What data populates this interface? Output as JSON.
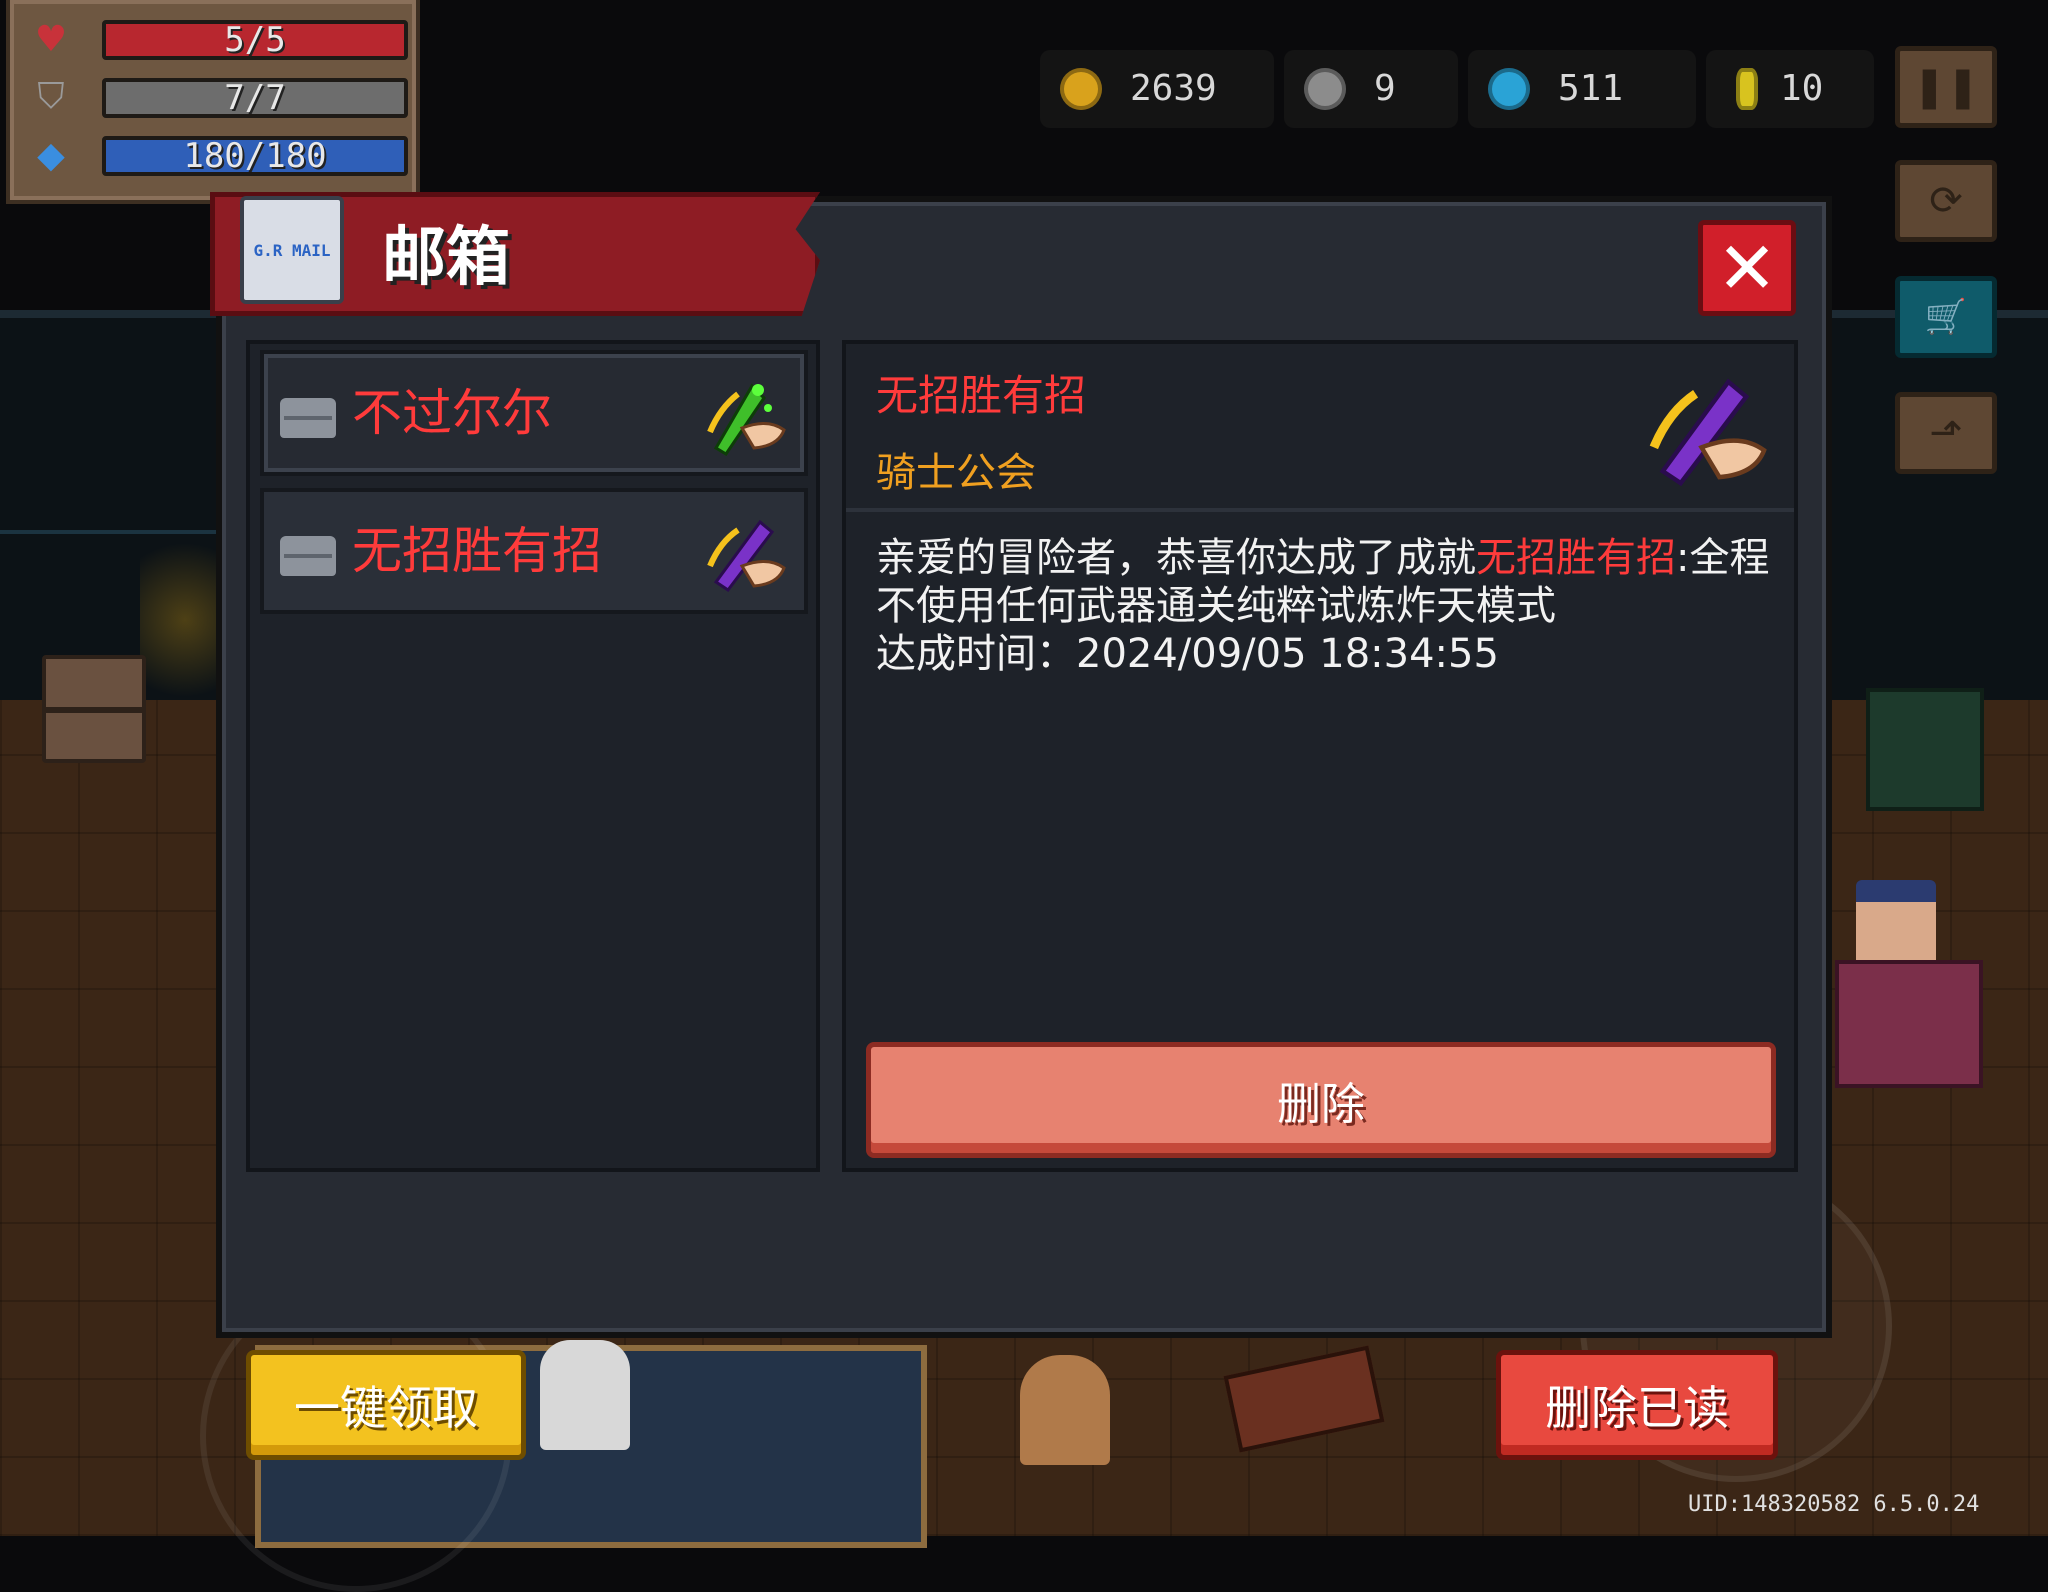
{
  "hud": {
    "health": {
      "value": "5/5",
      "fill": 1.0,
      "color": "#b8272f",
      "icon": "heart-icon"
    },
    "armor": {
      "value": "7/7",
      "fill": 1.0,
      "color": "#6d6d6d",
      "icon": "shield-icon"
    },
    "energy": {
      "value": "180/180",
      "fill": 1.0,
      "color": "#2f5fb8",
      "icon": "energy-crystal-icon"
    }
  },
  "currencies": [
    {
      "icon": "gold-coin-icon",
      "value": "2639",
      "color": "#d9a21c"
    },
    {
      "icon": "fish-icon",
      "value": "9",
      "color": "#8c8c8c"
    },
    {
      "icon": "gem-icon",
      "value": "511",
      "color": "#2aa3d6"
    },
    {
      "icon": "token-icon",
      "value": "10",
      "color": "#d8c31f"
    }
  ],
  "side_buttons": [
    {
      "name": "pause-button",
      "icon": "pause-icon",
      "glyph": "❚❚"
    },
    {
      "name": "switch-character-button",
      "icon": "refresh-icon",
      "glyph": "⟳"
    },
    {
      "name": "shop-button",
      "icon": "cart-icon",
      "glyph": "🛒"
    },
    {
      "name": "exit-button",
      "icon": "exit-icon",
      "glyph": "⬏"
    }
  ],
  "mailbox": {
    "title": "邮箱",
    "icon_text": "G.R MAIL",
    "mails": [
      {
        "title": "不过尔尔",
        "icon": "green-blade-hand-icon"
      },
      {
        "title": "无招胜有招",
        "icon": "purple-blade-hand-icon"
      }
    ],
    "detail": {
      "title": "无招胜有招",
      "sender": "骑士公会",
      "body_prefix": "亲爱的冒险者，恭喜你达成了成就",
      "body_highlight": "无招胜有招",
      "body_suffix": ":全程不使用任何武器通关纯粹试炼炸天模式",
      "time_label": "达成时间：2024/09/05 18:34:55"
    },
    "delete_label": "删除",
    "claim_all_label": "一键领取",
    "delete_read_label": "删除已读"
  },
  "footer": {
    "uid_version": "UID:148320582 6.5.0.24"
  }
}
